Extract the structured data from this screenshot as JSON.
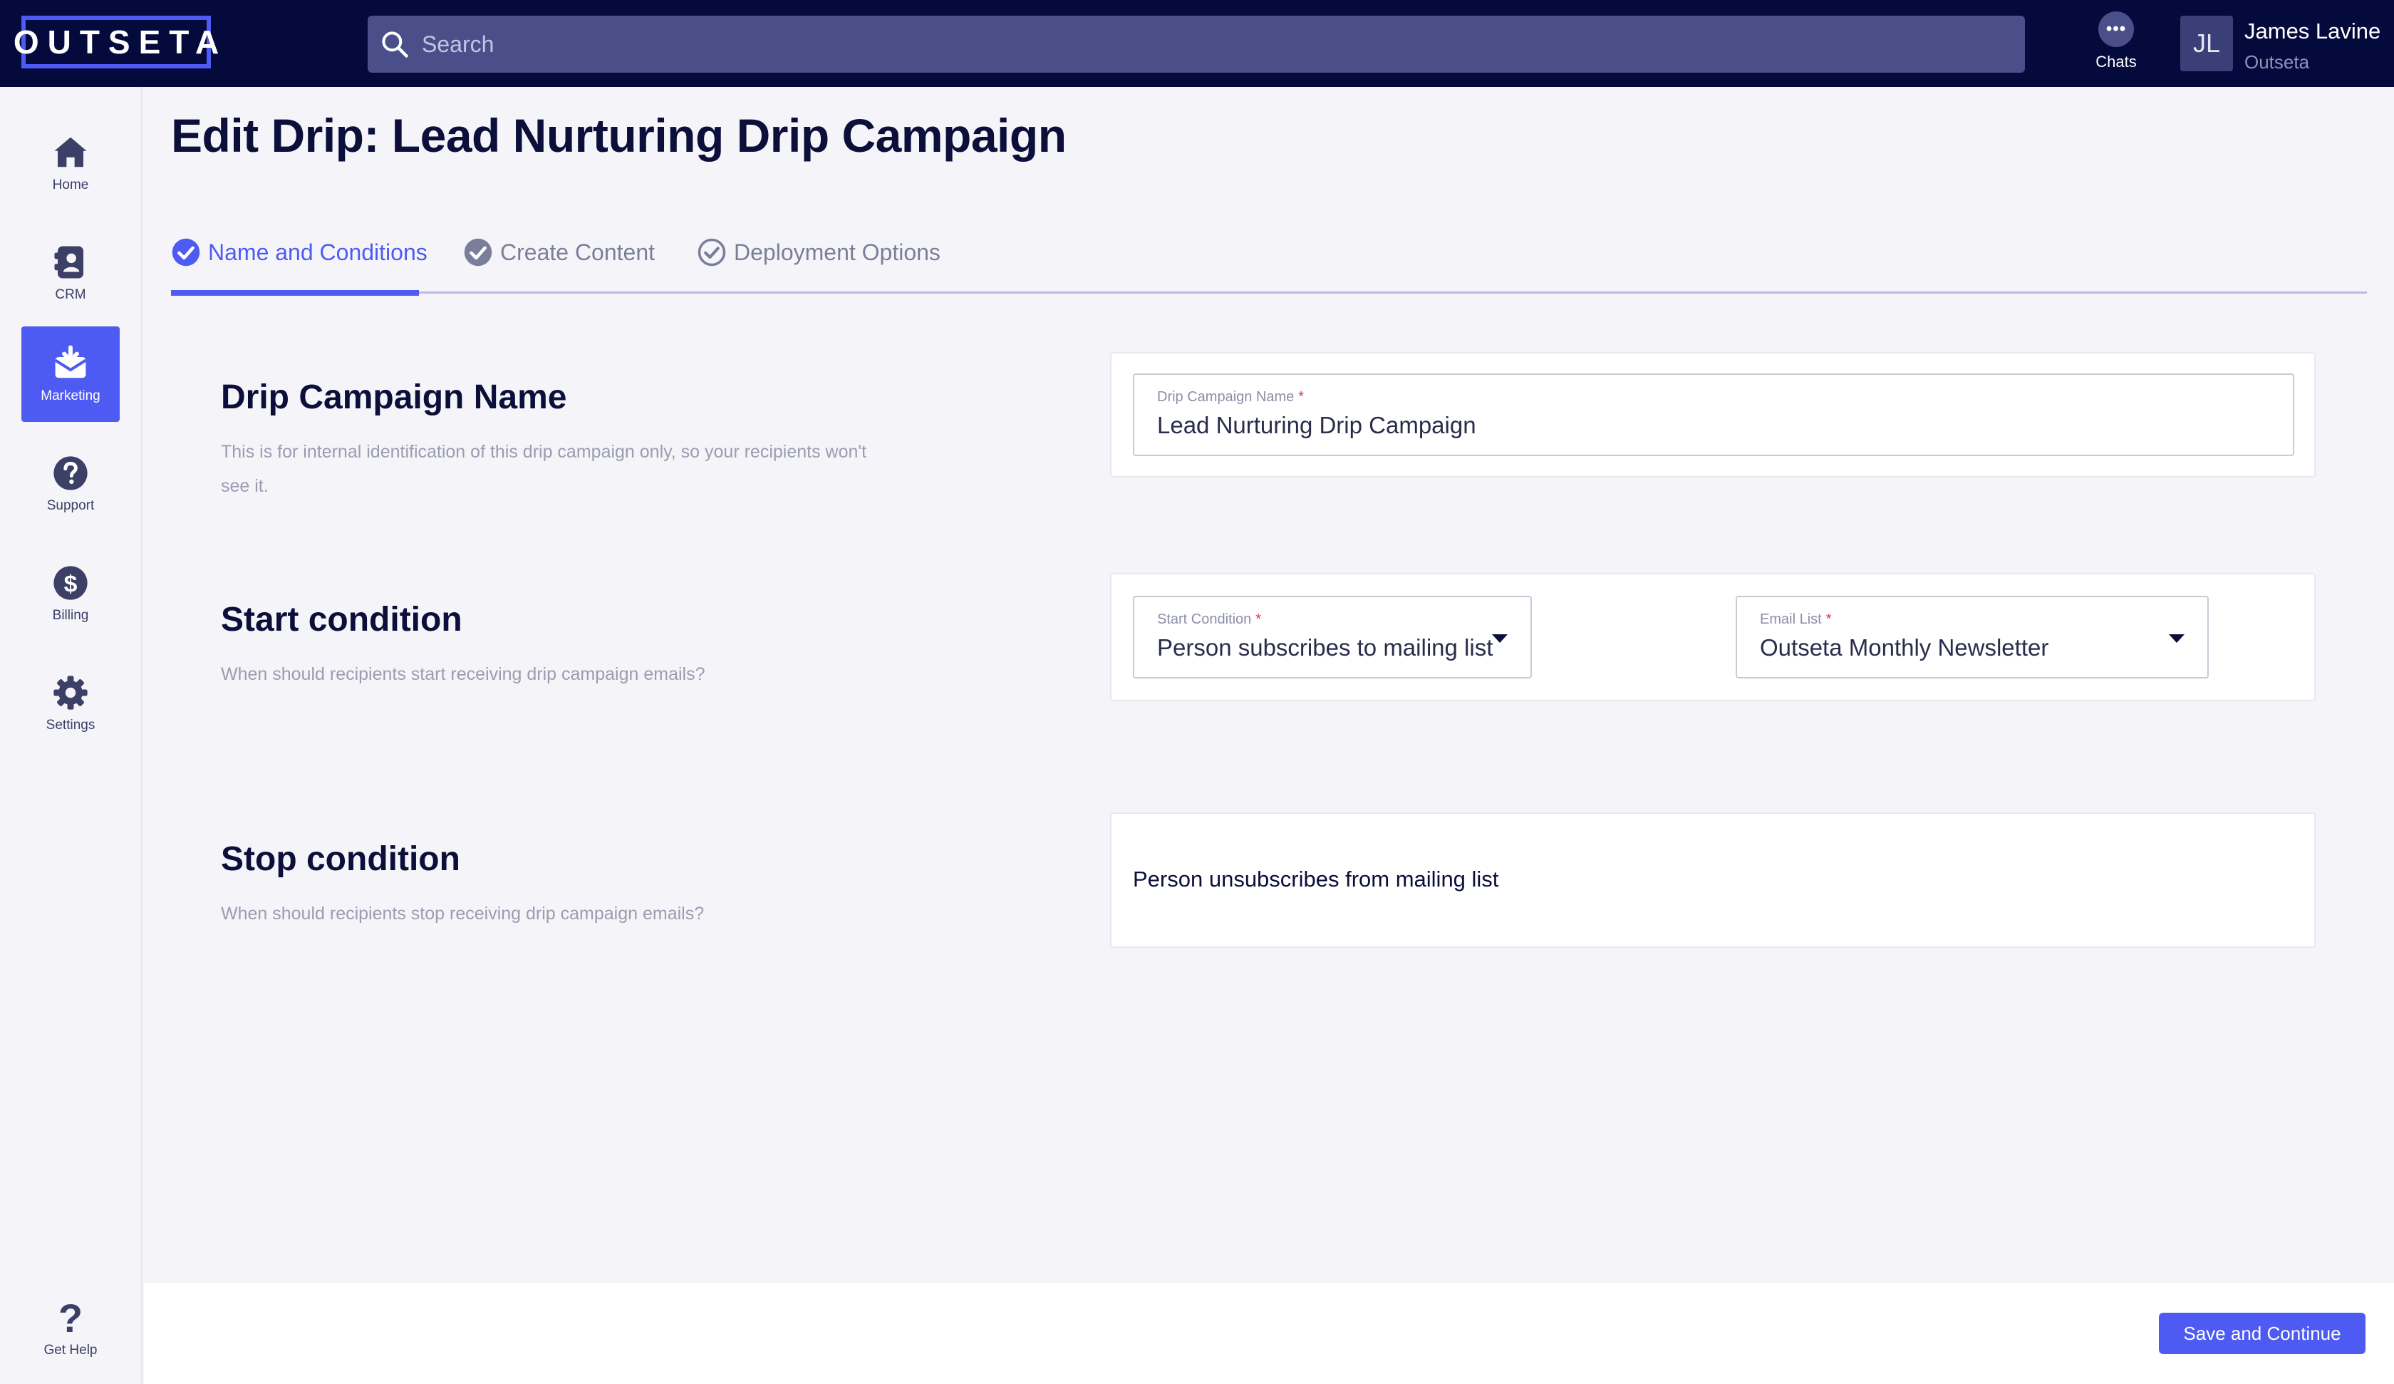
{
  "app": {
    "logo_text": "OUTSETA",
    "accent_color": "#4e5bf2",
    "topbar_color": "#050a3d"
  },
  "header": {
    "search_placeholder": "Search",
    "chats_label": "Chats",
    "chats_icon": "chat-bubble-icon",
    "user_initials": "JL",
    "user_name": "James Lavine",
    "user_org": "Outseta"
  },
  "sidebar": {
    "items": [
      {
        "label": "Home",
        "icon": "home-icon",
        "active": false
      },
      {
        "label": "CRM",
        "icon": "crm-icon",
        "active": false
      },
      {
        "label": "Marketing",
        "icon": "marketing-icon",
        "active": true
      },
      {
        "label": "Support",
        "icon": "support-icon",
        "active": false
      },
      {
        "label": "Billing",
        "icon": "billing-icon",
        "active": false
      },
      {
        "label": "Settings",
        "icon": "gear-icon",
        "active": false
      }
    ],
    "help_label": "Get Help"
  },
  "page": {
    "title": "Edit Drip: Lead Nurturing Drip Campaign",
    "tabs": [
      {
        "label": "Name and Conditions",
        "active": true
      },
      {
        "label": "Create Content",
        "active": false
      },
      {
        "label": "Deployment Options",
        "active": false
      }
    ]
  },
  "sections": {
    "name": {
      "title": "Drip Campaign Name",
      "description": "This is for internal identification of this drip campaign only, so your recipients won't see it.",
      "field_label": "Drip Campaign Name",
      "field_value": "Lead Nurturing Drip Campaign"
    },
    "start": {
      "title": "Start condition",
      "description": "When should recipients start receiving drip campaign emails?",
      "condition_label": "Start Condition",
      "condition_value": "Person subscribes to mailing list",
      "list_label": "Email List",
      "list_value": "Outseta Monthly Newsletter"
    },
    "stop": {
      "title": "Stop condition",
      "description": "When should recipients stop receiving drip campaign emails?",
      "value": "Person unsubscribes from mailing list"
    }
  },
  "footer": {
    "save_label": "Save and Continue"
  }
}
